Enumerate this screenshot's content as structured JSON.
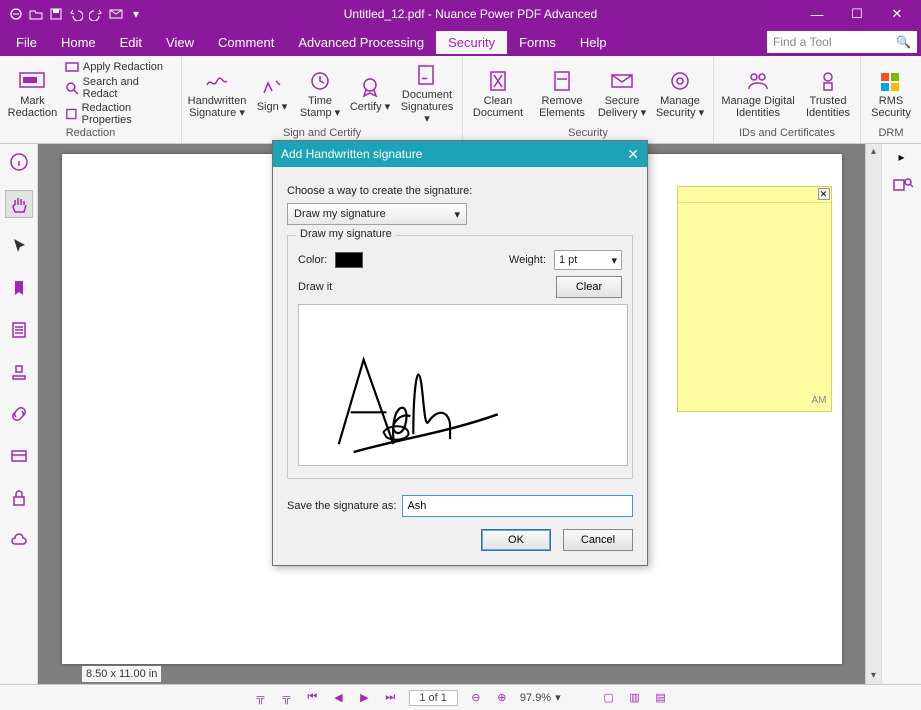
{
  "titlebar": {
    "title": "Untitled_12.pdf - Nuance Power PDF Advanced"
  },
  "menubar": {
    "items": [
      "File",
      "Home",
      "Edit",
      "View",
      "Comment",
      "Advanced Processing",
      "Security",
      "Forms",
      "Help"
    ],
    "active": "Security",
    "search_placeholder": "Find a Tool"
  },
  "ribbon": {
    "redaction": {
      "label": "Redaction",
      "mark": "Mark\nRedaction",
      "items": [
        "Apply Redaction",
        "Search and Redact",
        "Redaction Properties"
      ]
    },
    "sign": {
      "label": "Sign and Certify",
      "items": [
        {
          "label": "Handwritten\nSignature",
          "drop": true
        },
        {
          "label": "Sign",
          "drop": true
        },
        {
          "label": "Time\nStamp",
          "drop": true
        },
        {
          "label": "Certify",
          "drop": true
        },
        {
          "label": "Document\nSignatures",
          "drop": true
        }
      ]
    },
    "security": {
      "label": "Security",
      "items": [
        {
          "label": "Clean\nDocument"
        },
        {
          "label": "Remove\nElements"
        },
        {
          "label": "Secure\nDelivery",
          "drop": true
        },
        {
          "label": "Manage\nSecurity",
          "drop": true
        }
      ]
    },
    "ids": {
      "label": "IDs and Certificates",
      "items": [
        {
          "label": "Manage Digital\nIdentities"
        },
        {
          "label": "Trusted\nIdentities"
        }
      ]
    },
    "drm": {
      "label": "DRM",
      "items": [
        {
          "label": "RMS\nSecurity"
        }
      ]
    }
  },
  "note": {
    "time": "AM"
  },
  "statusbar": {
    "dimensions": "8.50 x 11.00 in",
    "page": "1 of 1",
    "zoom": "97.9%"
  },
  "modal": {
    "title": "Add Handwritten signature",
    "choose_label": "Choose a way to create the signature:",
    "method": "Draw my signature",
    "group_legend": "Draw my signature",
    "color_label": "Color:",
    "weight_label": "Weight:",
    "weight_value": "1 pt",
    "drawit_label": "Draw it",
    "clear": "Clear",
    "save_label": "Save the signature as:",
    "save_value": "Ash",
    "ok": "OK",
    "cancel": "Cancel"
  }
}
